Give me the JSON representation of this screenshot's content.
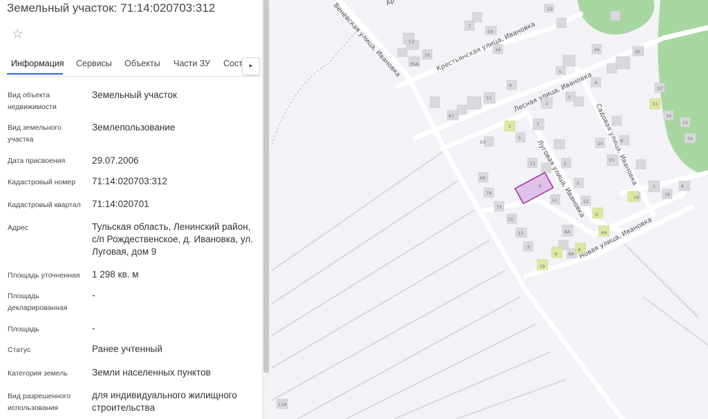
{
  "panel": {
    "title": "Земельный участок: 71:14:020703:312",
    "favorite_icon": "star-icon",
    "tabs": [
      "Информация",
      "Сервисы",
      "Объекты",
      "Части ЗУ",
      "Соста"
    ],
    "tabs_arrow": "▸",
    "fields": [
      {
        "label": "Вид объекта недвижимости",
        "value": "Земельный участок"
      },
      {
        "label": "Вид земельного участка",
        "value": "Землепользование"
      },
      {
        "label": "Дата присвоения",
        "value": "29.07.2006"
      },
      {
        "label": "Кадастровый номер",
        "value": "71:14:020703:312"
      },
      {
        "label": "Кадастровый квартал",
        "value": "71:14:020701"
      },
      {
        "label": "Адрес",
        "value": "Тульская область, Ленинский район, с/п Рождественское, д. Ивановка, ул. Луговая, дом 9"
      },
      {
        "label": "Площадь уточненная",
        "value": "1 298 кв. м"
      },
      {
        "label": "Площадь декларированная",
        "value": "-"
      },
      {
        "label": "Площадь",
        "value": "-"
      },
      {
        "label": "Статус",
        "value": "Ранее учтенный"
      },
      {
        "label": "Категория земель",
        "value": "Земли населенных пунктов"
      },
      {
        "label": "Вид разрешенного использования",
        "value": "для индивидуального жилищного строительства"
      }
    ]
  },
  "map": {
    "streets": [
      "Веневская улица, Ивановка",
      "Крестьянская улица, Ивановка",
      "Лесная улица, Ивановка",
      "Луговая улица, Ивановка",
      "Садовая улица, Ивановка",
      "Новая улица, Ивановка",
      "Ар"
    ],
    "house_numbers": [
      "22",
      "7",
      "19",
      "16",
      "53",
      "55",
      "35А",
      "26",
      "30",
      "9",
      "5",
      "4",
      "2",
      "11",
      "61",
      "1",
      "3",
      "63",
      "7",
      "3",
      "10",
      "11",
      "15",
      "8",
      "32",
      "33",
      "34",
      "25",
      "36",
      "16",
      "18",
      "4",
      "1",
      "69",
      "78",
      "9",
      "71",
      "11",
      "12",
      "72",
      "13",
      "6",
      "4А",
      "2",
      "5",
      "3",
      "8А",
      "9",
      "8",
      "6А",
      "18",
      "11А"
    ],
    "selected_parcel": "9",
    "colors": {
      "background": "#f3f2f6",
      "forest": "#a8d6a0",
      "parcel_stroke": "#9b2ea0",
      "parcel_fill": "#dcb3e6",
      "highlight": "#dde8a2"
    }
  }
}
